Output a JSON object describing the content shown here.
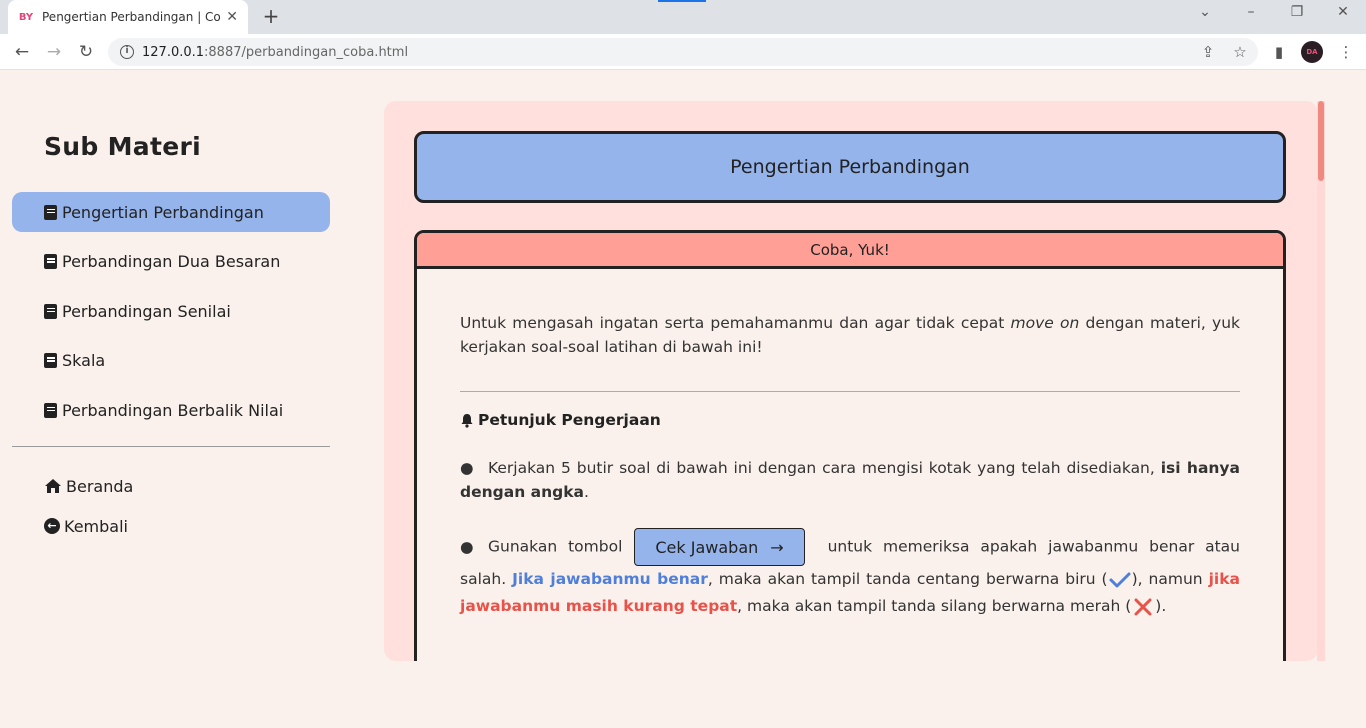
{
  "browser": {
    "tab_title": "Pengertian Perbandingan | Coba",
    "favicon_text": "BY",
    "url_host": "127.0.0.1",
    "url_path": ":8887/perbandingan_coba.html",
    "avatar_text": "DA"
  },
  "sidebar": {
    "heading": "Sub Materi",
    "items": [
      {
        "label": "Pengertian Perbandingan",
        "active": true
      },
      {
        "label": "Perbandingan Dua Besaran"
      },
      {
        "label": "Perbandingan Senilai"
      },
      {
        "label": "Skala"
      },
      {
        "label": "Perbandingan Berbalik Nilai"
      }
    ],
    "links": {
      "home": "Beranda",
      "back": "Kembali"
    }
  },
  "main": {
    "title": "Pengertian Perbandingan",
    "card_title": "Coba, Yuk!",
    "intro_before": "Untuk mengasah ingatan serta pemahamanmu dan agar tidak cepat ",
    "intro_em": "move on",
    "intro_after": " dengan materi, yuk kerjakan soal-soal latihan di bawah ini!",
    "petunjuk_title": "Petunjuk Pengerjaan",
    "instr1_text": "Kerjakan 5 butir soal di bawah ini dengan cara mengisi kotak yang telah disediakan, ",
    "instr1_bold": "isi hanya dengan angka",
    "instr1_end": ".",
    "instr2_start": "Gunakan tombol",
    "cek_button": "Cek Jawaban",
    "cek_arrow": "→",
    "instr2_mid": " untuk memeriksa apakah jawabanmu benar atau salah. ",
    "instr2_blue": "Jika jawabanmu benar",
    "instr2_after_blue": ", maka akan tampil tanda centang berwarna biru (",
    "instr2_close1": "), namun ",
    "instr2_red": "jika jawabanmu masih kurang tepat",
    "instr2_after_red": ", maka akan tampil tanda silang berwarna merah (",
    "instr2_close2": ")."
  },
  "colors": {
    "accent_blue": "#95b4ec",
    "card_header": "#ff9f96",
    "correct": "#4f7fd9",
    "wrong": "#e8524a"
  }
}
